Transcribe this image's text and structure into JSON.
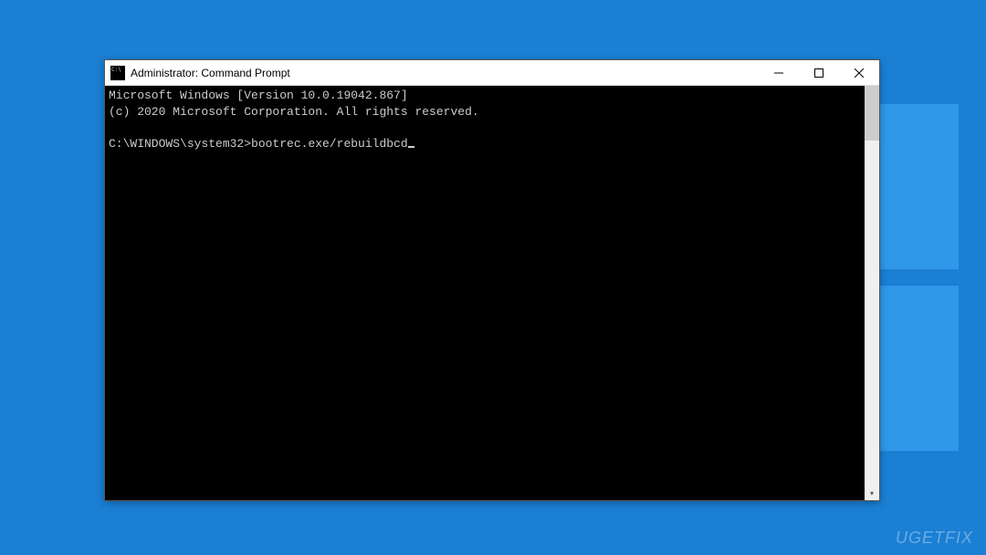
{
  "window": {
    "title": "Administrator: Command Prompt"
  },
  "terminal": {
    "line1": "Microsoft Windows [Version 10.0.19042.867]",
    "line2": "(c) 2020 Microsoft Corporation. All rights reserved.",
    "blank": "",
    "prompt": "C:\\WINDOWS\\system32>",
    "command": "bootrec.exe/rebuildbcd"
  },
  "watermark": "UGETFIX"
}
